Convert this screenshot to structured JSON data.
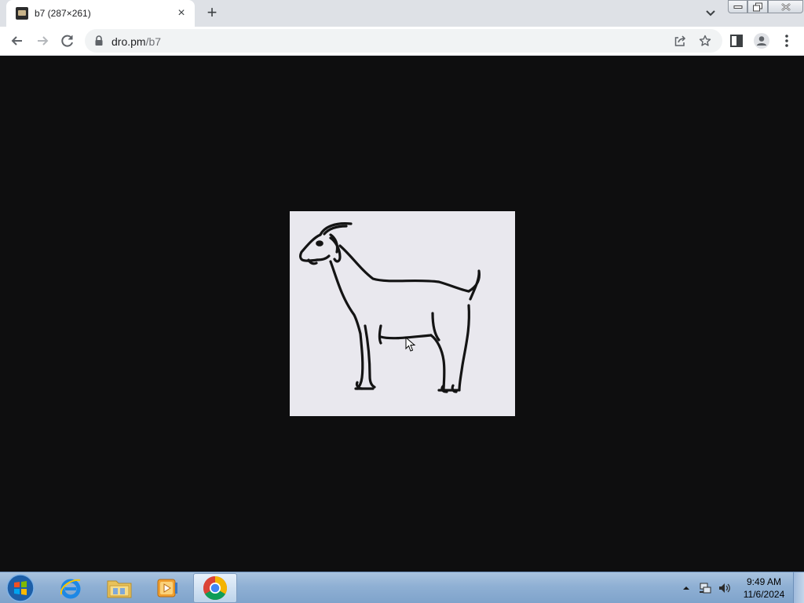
{
  "browser": {
    "tab": {
      "title": "b7 (287×261)",
      "favicon": "image-thumbnail-icon"
    },
    "new_tab_label": "+",
    "close_label": "×",
    "url": {
      "host": "dro.pm",
      "path": "/b7"
    },
    "toolbar_icons": [
      "back-icon",
      "forward-icon",
      "reload-icon",
      "lock-icon",
      "share-icon",
      "star-icon",
      "side-panel-icon",
      "profile-icon",
      "menu-icon"
    ]
  },
  "viewer": {
    "background": "#0e0e0f",
    "image": {
      "alt": "goat line drawing",
      "natural_width": 287,
      "natural_height": 261
    }
  },
  "taskbar": {
    "pinned": [
      "start-orb-icon",
      "internet-explorer-icon",
      "file-explorer-icon",
      "media-player-icon",
      "chrome-icon"
    ],
    "active": "chrome-icon",
    "clock": {
      "time": "9:49 AM",
      "date": "11/6/2024"
    }
  }
}
